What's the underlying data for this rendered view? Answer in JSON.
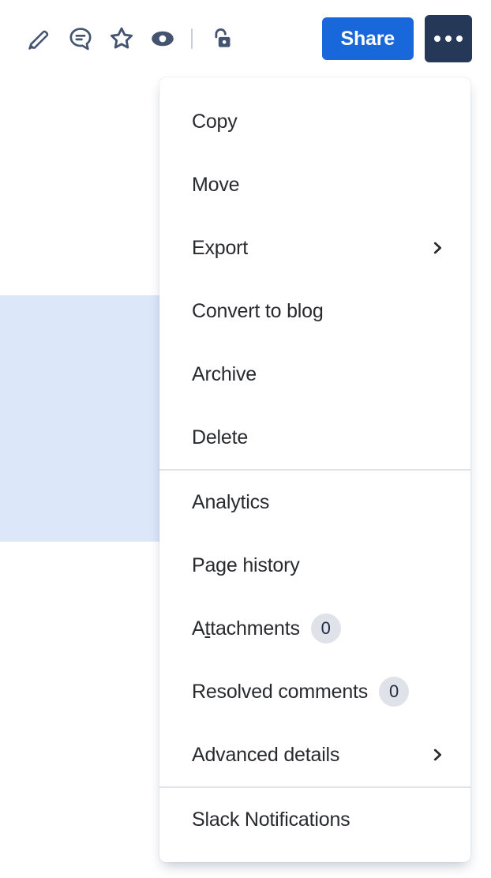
{
  "toolbar": {
    "items": [
      {
        "name": "edit-icon",
        "label": "Edit"
      },
      {
        "name": "comment-icon",
        "label": "Comment"
      },
      {
        "name": "star-icon",
        "label": "Star"
      },
      {
        "name": "watch-eye-icon",
        "label": "Watch"
      },
      {
        "name": "unlock-icon",
        "label": "Restrictions"
      }
    ],
    "share_label": "Share",
    "more_label": "More actions",
    "share_bg": "#1868DB",
    "more_bg": "#253858",
    "icon_color": "#44546F"
  },
  "menu": {
    "groups": [
      {
        "items": [
          {
            "label": "Copy",
            "name": "menu-item-copy",
            "badge": null,
            "chevron": false
          },
          {
            "label": "Move",
            "name": "menu-item-move",
            "badge": null,
            "chevron": false
          },
          {
            "label": "Export",
            "name": "menu-item-export",
            "badge": null,
            "chevron": true
          },
          {
            "label": "Convert to blog",
            "name": "menu-item-convert-to-blog",
            "badge": null,
            "chevron": false
          },
          {
            "label": "Archive",
            "name": "menu-item-archive",
            "badge": null,
            "chevron": false
          },
          {
            "label": "Delete",
            "name": "menu-item-delete",
            "badge": null,
            "chevron": false
          }
        ]
      },
      {
        "items": [
          {
            "label": "Analytics",
            "name": "menu-item-analytics",
            "badge": null,
            "chevron": false
          },
          {
            "label": "Page history",
            "name": "menu-item-page-history",
            "badge": null,
            "chevron": false
          },
          {
            "label": "Attachments",
            "name": "menu-item-attachments",
            "badge": "0",
            "chevron": false,
            "accesskey_index": 1
          },
          {
            "label": "Resolved comments",
            "name": "menu-item-resolved-comments",
            "badge": "0",
            "chevron": false
          },
          {
            "label": "Advanced details",
            "name": "menu-item-advanced-details",
            "badge": null,
            "chevron": true
          }
        ]
      },
      {
        "items": [
          {
            "label": "Slack Notifications",
            "name": "menu-item-slack-notifications",
            "badge": null,
            "chevron": false
          }
        ]
      }
    ],
    "badge_bg": "#DFE2E8",
    "badge_color": "#1C2B41",
    "divider_color": "#DFE3EA",
    "background": "#FFFFFF"
  },
  "page": {
    "highlight_color": "#DCE7F9",
    "background": "#FFFFFF"
  }
}
